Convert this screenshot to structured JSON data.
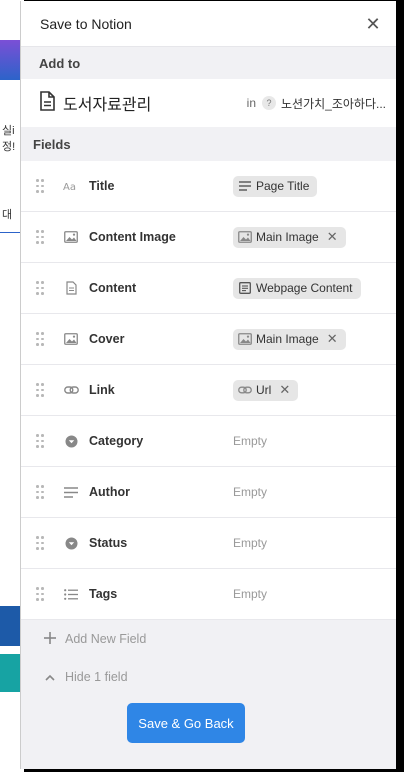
{
  "background_page": {
    "text_fragments": [
      "실i",
      "정!",
      "대"
    ],
    "stripe_colors": [
      "#7b4fd6",
      "#2c63c9",
      "#1d5aa8",
      "#1a6e8a",
      "#17a3a3"
    ]
  },
  "header": {
    "title": "Save to Notion",
    "close_icon": "close-icon"
  },
  "add_to": {
    "section_label": "Add to",
    "database_name": "도서자료관리",
    "in_label": "in",
    "help_glyph": "?",
    "workspace": "노션가치_조아하다..."
  },
  "fields": {
    "section_label": "Fields",
    "rows": [
      {
        "name": "Title",
        "icon": "text-aa-icon",
        "value": "Page Title",
        "value_icon": "lines-icon",
        "removable": false
      },
      {
        "name": "Content Image",
        "icon": "image-icon",
        "value": "Main Image",
        "value_icon": "image-icon",
        "removable": true
      },
      {
        "name": "Content",
        "icon": "document-icon",
        "value": "Webpage Content",
        "value_icon": "webpage-icon",
        "removable": false
      },
      {
        "name": "Cover",
        "icon": "image-icon",
        "value": "Main Image",
        "value_icon": "image-icon",
        "removable": true
      },
      {
        "name": "Link",
        "icon": "link-icon",
        "value": "Url",
        "value_icon": "link-icon",
        "removable": true
      },
      {
        "name": "Category",
        "icon": "select-icon",
        "value": "Empty",
        "empty": true
      },
      {
        "name": "Author",
        "icon": "text-lines-icon",
        "value": "Empty",
        "empty": true
      },
      {
        "name": "Status",
        "icon": "select-icon",
        "value": "Empty",
        "empty": true
      },
      {
        "name": "Tags",
        "icon": "list-icon",
        "value": "Empty",
        "empty": true
      }
    ]
  },
  "actions": {
    "add_field": "Add New Field",
    "hide_fields": "Hide 1 field"
  },
  "footer": {
    "save_label": "Save & Go Back"
  },
  "colors": {
    "accent": "#2f86e6",
    "panel_bg": "#f1f1f4",
    "chip_bg": "#e6e6e6"
  }
}
